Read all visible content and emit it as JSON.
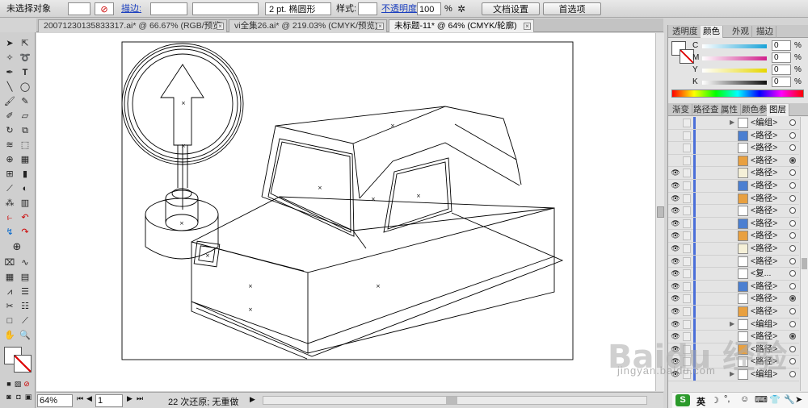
{
  "control_bar": {
    "selection_label": "未选择对象",
    "stroke_link": "描边:",
    "brush_size": "2 pt. 椭圆形",
    "style_label": "样式:",
    "opacity_link": "不透明度:",
    "opacity_value": "100",
    "opacity_unit": "%",
    "doc_setup_button": "文档设置",
    "preferences_button": "首选项"
  },
  "tabs": [
    {
      "label": "20071230135833317.ai* @ 66.67% (RGB/预览)",
      "active": false
    },
    {
      "label": "vi全集26.ai* @ 219.03% (CMYK/预览)",
      "active": false
    },
    {
      "label": "未标题-11* @ 64% (CMYK/轮廓)",
      "active": true
    }
  ],
  "color_panel": {
    "tabs": [
      "透明度",
      "颜色",
      "外观",
      "描边"
    ],
    "channels": [
      {
        "label": "C",
        "value": "0",
        "unit": "%",
        "color": "#1aa3d8"
      },
      {
        "label": "M",
        "value": "0",
        "unit": "%",
        "color": "#d0208c"
      },
      {
        "label": "Y",
        "value": "0",
        "unit": "%",
        "color": "#e6d600"
      },
      {
        "label": "K",
        "value": "0",
        "unit": "%",
        "color": "#111111"
      }
    ]
  },
  "layers_panel": {
    "tabs": [
      "渐变",
      "路径查",
      "属性",
      "颜色参",
      "图层"
    ],
    "rows": [
      {
        "name": "<编组>",
        "expand": true,
        "visible": false,
        "selected": false
      },
      {
        "name": "<路径>",
        "expand": false,
        "visible": false,
        "selected": false
      },
      {
        "name": "<路径>",
        "expand": false,
        "visible": false,
        "selected": false
      },
      {
        "name": "<路径>",
        "expand": false,
        "visible": false,
        "selected": true
      },
      {
        "name": "<路径>",
        "expand": false,
        "visible": true,
        "selected": false
      },
      {
        "name": "<路径>",
        "expand": false,
        "visible": true,
        "selected": false
      },
      {
        "name": "<路径>",
        "expand": false,
        "visible": true,
        "selected": false
      },
      {
        "name": "<路径>",
        "expand": false,
        "visible": true,
        "selected": false
      },
      {
        "name": "<路径>",
        "expand": false,
        "visible": true,
        "selected": false
      },
      {
        "name": "<路径>",
        "expand": false,
        "visible": true,
        "selected": false
      },
      {
        "name": "<路径>",
        "expand": false,
        "visible": true,
        "selected": false
      },
      {
        "name": "<路径>",
        "expand": false,
        "visible": true,
        "selected": false
      },
      {
        "name": "<复...",
        "expand": false,
        "visible": true,
        "selected": false
      },
      {
        "name": "<路径>",
        "expand": false,
        "visible": true,
        "selected": false
      },
      {
        "name": "<路径>",
        "expand": false,
        "visible": true,
        "selected": true
      },
      {
        "name": "<路径>",
        "expand": false,
        "visible": true,
        "selected": false
      },
      {
        "name": "<编组>",
        "expand": true,
        "visible": true,
        "selected": false
      },
      {
        "name": "<路径>",
        "expand": false,
        "visible": true,
        "selected": true
      },
      {
        "name": "<路径>",
        "expand": false,
        "visible": true,
        "selected": false
      },
      {
        "name": "<路径>",
        "expand": false,
        "visible": true,
        "selected": false
      },
      {
        "name": "<编组>",
        "expand": true,
        "visible": true,
        "selected": false
      }
    ]
  },
  "status_bar": {
    "zoom": "64%",
    "page": "1",
    "undo_text": "22 次还原; 无重做"
  },
  "watermark": {
    "brand": "Baidu 经验",
    "url": "jingyan.baidu.com"
  },
  "ime": {
    "lang": "英"
  }
}
